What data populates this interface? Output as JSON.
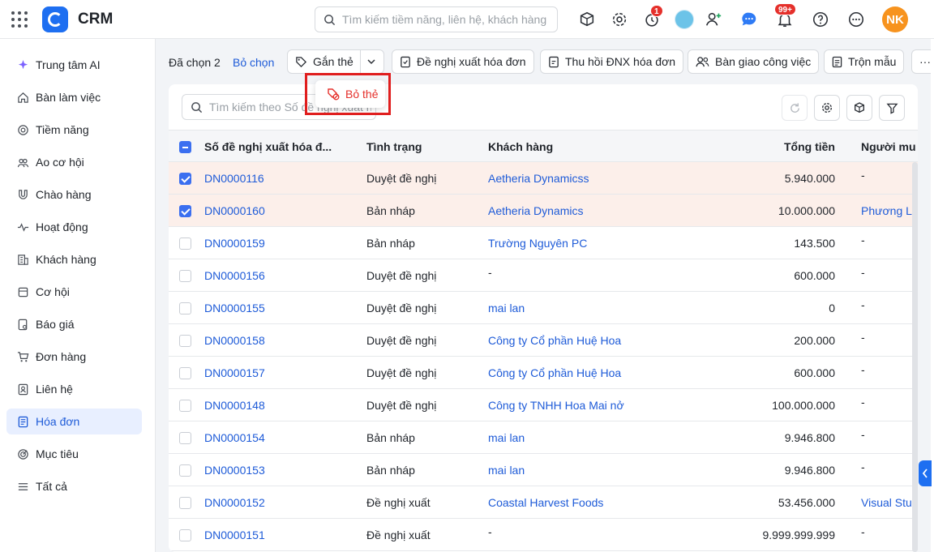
{
  "app": {
    "name": "CRM"
  },
  "top": {
    "search_placeholder": "Tìm kiếm tiềm năng, liên hệ, khách hàng",
    "timer_badge": "1",
    "notif_badge": "99+",
    "user_initials": "NK"
  },
  "sidebar": {
    "items": [
      {
        "label": "Trung tâm AI",
        "icon": "sparkle-icon"
      },
      {
        "label": "Bàn làm việc",
        "icon": "home-icon"
      },
      {
        "label": "Tiềm năng",
        "icon": "target-icon"
      },
      {
        "label": "Ao cơ hội",
        "icon": "people-icon"
      },
      {
        "label": "Chào hàng",
        "icon": "magnet-icon"
      },
      {
        "label": "Hoạt động",
        "icon": "pulse-icon"
      },
      {
        "label": "Khách hàng",
        "icon": "building-icon"
      },
      {
        "label": "Cơ hội",
        "icon": "box-icon"
      },
      {
        "label": "Báo giá",
        "icon": "quote-icon"
      },
      {
        "label": "Đơn hàng",
        "icon": "cart-icon"
      },
      {
        "label": "Liên hệ",
        "icon": "contact-icon"
      },
      {
        "label": "Hóa đơn",
        "icon": "invoice-icon",
        "active": true
      },
      {
        "label": "Mục tiêu",
        "icon": "goal-icon"
      },
      {
        "label": "Tất cả",
        "icon": "menu-icon"
      }
    ]
  },
  "actions": {
    "selected_text": "Đã chọn 2",
    "unselect_label": "Bỏ chọn",
    "tag_label": "Gắn thẻ",
    "untag_label": "Bỏ thẻ",
    "request_invoice_label": "Đề nghị xuất hóa đơn",
    "revoke_label": "Thu hồi ĐNX hóa đơn",
    "handover_label": "Bàn giao công việc",
    "merge_label": "Trộn mẫu",
    "more_label": "···"
  },
  "table": {
    "search_placeholder": "Tìm kiếm theo Số đề nghị xuất hóa đơn",
    "columns": {
      "number": "Số đề nghị xuất hóa đ...",
      "status": "Tình trạng",
      "customer": "Khách hàng",
      "total": "Tổng tiền",
      "buyer": "Người mu"
    },
    "rows": [
      {
        "number": "DN0000116",
        "status": "Duyệt đề nghị",
        "customer": "Aetheria Dynamicss",
        "total": "5.940.000",
        "buyer": "-",
        "selected": true
      },
      {
        "number": "DN0000160",
        "status": "Bản nháp",
        "customer": "Aetheria Dynamics",
        "total": "10.000.000",
        "buyer": "Phương Li",
        "selected": true
      },
      {
        "number": "DN0000159",
        "status": "Bản nháp",
        "customer": "Trường Nguyên PC",
        "total": "143.500",
        "buyer": "-",
        "selected": false
      },
      {
        "number": "DN0000156",
        "status": "Duyệt đề nghị",
        "customer": "-",
        "total": "600.000",
        "buyer": "-",
        "selected": false
      },
      {
        "number": "DN0000155",
        "status": "Duyệt đề nghị",
        "customer": "mai lan",
        "total": "0",
        "buyer": "-",
        "selected": false
      },
      {
        "number": "DN0000158",
        "status": "Duyệt đề nghị",
        "customer": "Công ty Cổ phần Huệ Hoa",
        "total": "200.000",
        "buyer": "-",
        "selected": false
      },
      {
        "number": "DN0000157",
        "status": "Duyệt đề nghị",
        "customer": "Công ty Cổ phần Huệ Hoa",
        "total": "600.000",
        "buyer": "-",
        "selected": false
      },
      {
        "number": "DN0000148",
        "status": "Duyệt đề nghị",
        "customer": "Công ty TNHH Hoa Mai nở",
        "total": "100.000.000",
        "buyer": "-",
        "selected": false
      },
      {
        "number": "DN0000154",
        "status": "Bản nháp",
        "customer": "mai lan",
        "total": "9.946.800",
        "buyer": "-",
        "selected": false
      },
      {
        "number": "DN0000153",
        "status": "Bản nháp",
        "customer": "mai lan",
        "total": "9.946.800",
        "buyer": "-",
        "selected": false
      },
      {
        "number": "DN0000152",
        "status": "Đề nghị xuất",
        "customer": "Coastal Harvest Foods",
        "total": "53.456.000",
        "buyer": "Visual Stu",
        "selected": false
      },
      {
        "number": "DN0000151",
        "status": "Đề nghị xuất",
        "customer": "-",
        "total": "9.999.999.999",
        "buyer": "-",
        "selected": false
      }
    ]
  },
  "colors": {
    "accent": "#1e5bd8",
    "brand": "#1e6ff1",
    "highlight": "#e01e1e",
    "selected_row": "#fcefea"
  }
}
